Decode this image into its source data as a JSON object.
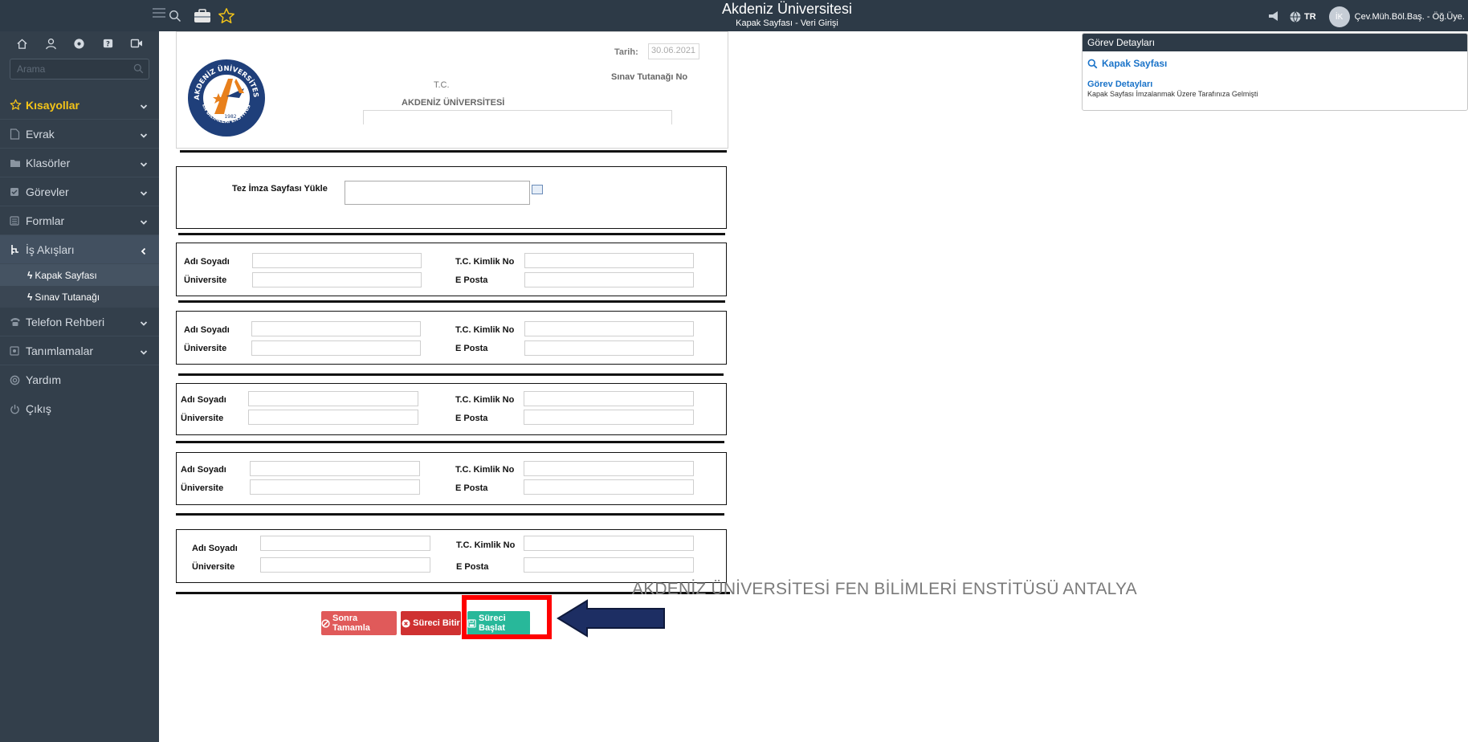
{
  "topbar": {
    "title": "Akdeniz Üniversitesi",
    "subtitle": "Kapak Sayfası - Veri Girişi",
    "language": "TR",
    "avatar_initials": "İK",
    "user_role": "Çev.Müh.Böl.Baş. - Öğ.Üye."
  },
  "sidebar": {
    "search_placeholder": "Arama",
    "items": [
      {
        "label": "Kısayollar",
        "icon": "star-icon"
      },
      {
        "label": "Evrak",
        "icon": "document-icon"
      },
      {
        "label": "Klasörler",
        "icon": "folder-icon"
      },
      {
        "label": "Görevler",
        "icon": "task-icon"
      },
      {
        "label": "Formlar",
        "icon": "form-icon"
      },
      {
        "label": "İş Akışları",
        "icon": "workflow-icon"
      },
      {
        "label": "Telefon Rehberi",
        "icon": "phone-icon"
      },
      {
        "label": "Tanımlamalar",
        "icon": "settings-icon"
      },
      {
        "label": "Yardım",
        "icon": "help-icon"
      },
      {
        "label": "Çıkış",
        "icon": "power-icon"
      }
    ],
    "subitems": [
      {
        "label": "Kapak Sayfası"
      },
      {
        "label": "Sınav Tutanağı"
      }
    ]
  },
  "form": {
    "header": {
      "date_label": "Tarih:",
      "date_value": "30.06.2021",
      "exam_record_label": "Sınav Tutanağı No",
      "tc_label": "T.C.",
      "university_label": "AKDENİZ ÜNİVERSİTESİ",
      "logo_text_top": "AKDENİZ ÜNİVERSİTESİ",
      "logo_text_bottom": "FEN BİLİMLERİ ENSTİTÜSÜ",
      "logo_year": "1982"
    },
    "upload_label": "Tez İmza Sayfası Yükle",
    "person_labels": {
      "name": "Adı Soyadı",
      "tc": "T.C. Kimlik No",
      "university": "Üniversite",
      "email": "E Posta"
    }
  },
  "buttons": {
    "later": "Sonra Tamamla",
    "finish": "Süreci Bitir",
    "start": "Süreci Başlat"
  },
  "panel": {
    "title": "Görev Detayları",
    "link": "Kapak Sayfası",
    "sub_title": "Görev Detayları",
    "text": "Kapak Sayfası İmzalanmak Üzere Tarafınıza Gelmişti"
  },
  "watermark": "AKDENİZ ÜNİVERSİTESİ FEN BİLİMLERİ ENSTİTÜSÜ ANTALYA",
  "colors": {
    "topbar": "#2d3a47",
    "sidebar": "#333f4b",
    "accent_yellow": "#f5c518",
    "link_blue": "#1a73c9",
    "btn_teal": "#28b89a",
    "btn_red": "#cf3131",
    "highlight": "#ff0000",
    "arrow": "#1d2e63"
  }
}
